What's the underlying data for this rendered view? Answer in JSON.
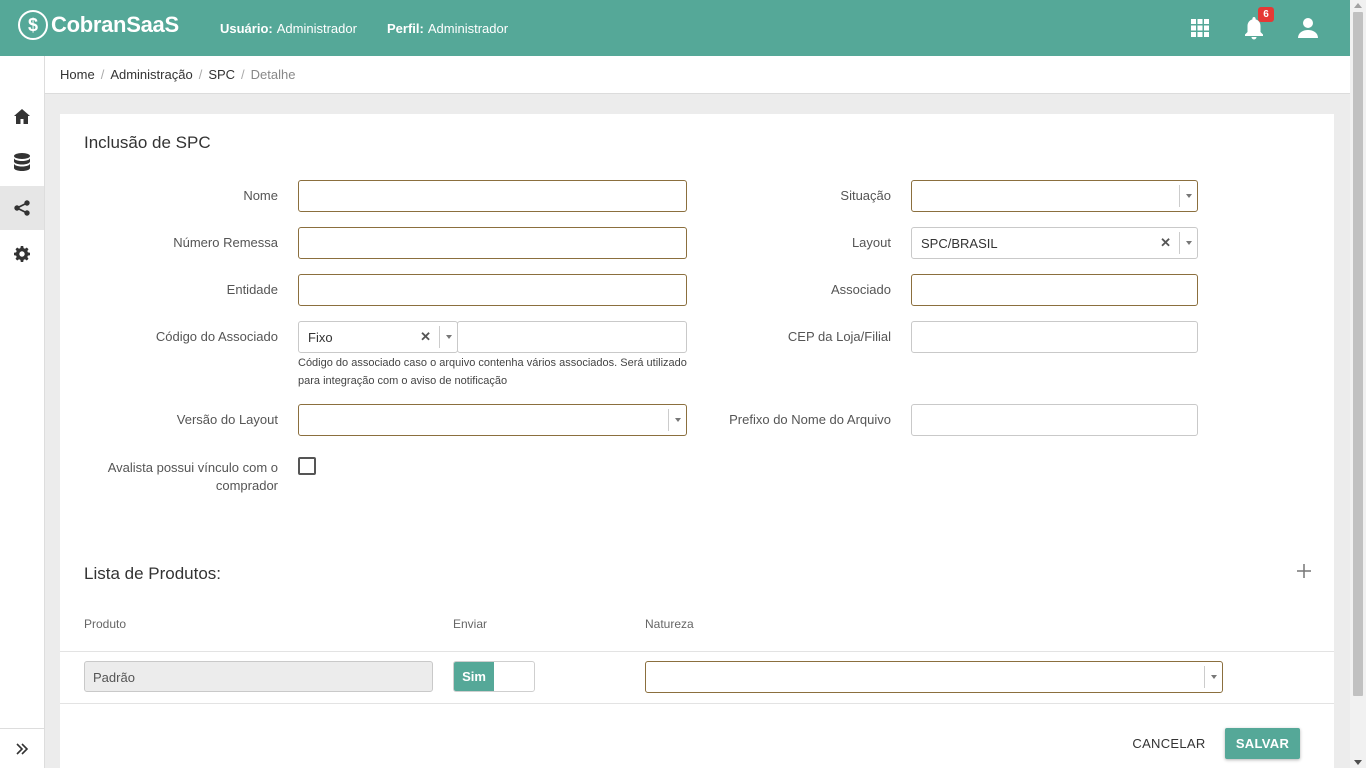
{
  "header": {
    "logo_text": "CobranSaaS",
    "user_label": "Usuário:",
    "user_value": "Administrador",
    "profile_label": "Perfil:",
    "profile_value": "Administrador",
    "notifications_count": "6",
    "brand_color": "#55a898"
  },
  "sidebar": {
    "items": [
      {
        "icon": "home-icon"
      },
      {
        "icon": "database-icon"
      },
      {
        "icon": "share-icon",
        "active": true
      },
      {
        "icon": "gear-icon"
      }
    ],
    "footer_icon": "expand-icon"
  },
  "breadcrumb": {
    "items": [
      "Home",
      "Administração",
      "SPC"
    ],
    "current": "Detalhe",
    "separator": "/"
  },
  "form": {
    "title": "Inclusão de SPC",
    "fields": {
      "nome": {
        "label": "Nome",
        "value": ""
      },
      "numero_remessa": {
        "label": "Número Remessa",
        "value": ""
      },
      "entidade": {
        "label": "Entidade",
        "value": ""
      },
      "codigo_associado": {
        "label": "Código do Associado",
        "select_value": "Fixo",
        "value": "",
        "help": "Código do associado caso o arquivo contenha vários associados. Será utilizado para integração com o aviso de notificação"
      },
      "versao_layout": {
        "label": "Versão do Layout",
        "value": ""
      },
      "avalista": {
        "label": "Avalista possui vínculo com o comprador",
        "checked": false
      },
      "situacao": {
        "label": "Situação",
        "value": ""
      },
      "layout": {
        "label": "Layout",
        "value": "SPC/BRASIL"
      },
      "associado": {
        "label": "Associado",
        "value": ""
      },
      "cep": {
        "label": "CEP da Loja/Filial",
        "value": ""
      },
      "prefixo": {
        "label": "Prefixo do Nome do Arquivo",
        "value": ""
      }
    }
  },
  "produtos": {
    "title": "Lista de Produtos:",
    "columns": [
      "Produto",
      "Enviar",
      "Natureza"
    ],
    "rows": [
      {
        "produto": "Padrão",
        "enviar": "Sim",
        "natureza": ""
      }
    ]
  },
  "actions": {
    "cancel": "CANCELAR",
    "save": "SALVAR"
  }
}
